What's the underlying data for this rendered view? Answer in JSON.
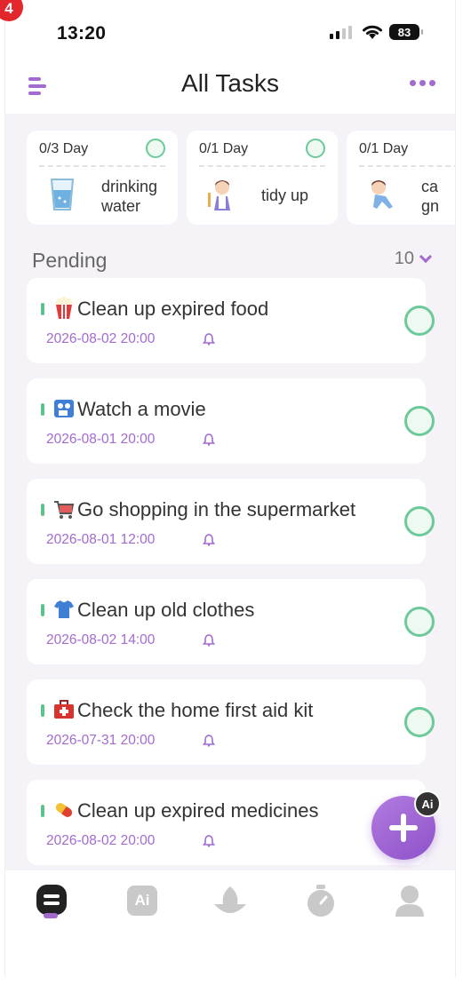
{
  "corner_badge": "4",
  "status": {
    "time": "13:20",
    "battery": "83"
  },
  "header": {
    "title": "All Tasks"
  },
  "habits": [
    {
      "count": "0/3 Day",
      "name_line1": "drinking",
      "name_line2": "water",
      "icon": "water-glass-icon"
    },
    {
      "count": "0/1 Day",
      "name_line1": "tidy up",
      "name_line2": "",
      "icon": "cleaning-girl-icon"
    },
    {
      "count": "0/1 Day",
      "name_line1": "ca",
      "name_line2": "gn",
      "icon": "exercise-girl-icon"
    }
  ],
  "pending": {
    "label": "Pending",
    "count": "10"
  },
  "tasks": [
    {
      "title": "Clean up expired food",
      "date": "2026-08-02 20:00",
      "emoji": "popcorn-icon"
    },
    {
      "title": "Watch a movie",
      "date": "2026-08-01 20:00",
      "emoji": "movie-camera-icon"
    },
    {
      "title": "Go shopping in the supermarket",
      "date": "2026-08-01 12:00",
      "emoji": "shopping-cart-icon"
    },
    {
      "title": "Clean up old clothes",
      "date": "2026-08-02 14:00",
      "emoji": "tshirt-icon"
    },
    {
      "title": "Check the home first aid kit",
      "date": "2026-07-31 20:00",
      "emoji": "first-aid-kit-icon"
    },
    {
      "title": "Clean up expired medicines",
      "date": "2026-08-02 20:00",
      "emoji": "pill-icon"
    }
  ],
  "fab": {
    "ai_badge": "Ai"
  },
  "tabbar": {
    "ai_label": "Ai"
  },
  "colors": {
    "accent": "#a36bd0",
    "check": "#6cc99a",
    "background": "#f6f3f8"
  }
}
